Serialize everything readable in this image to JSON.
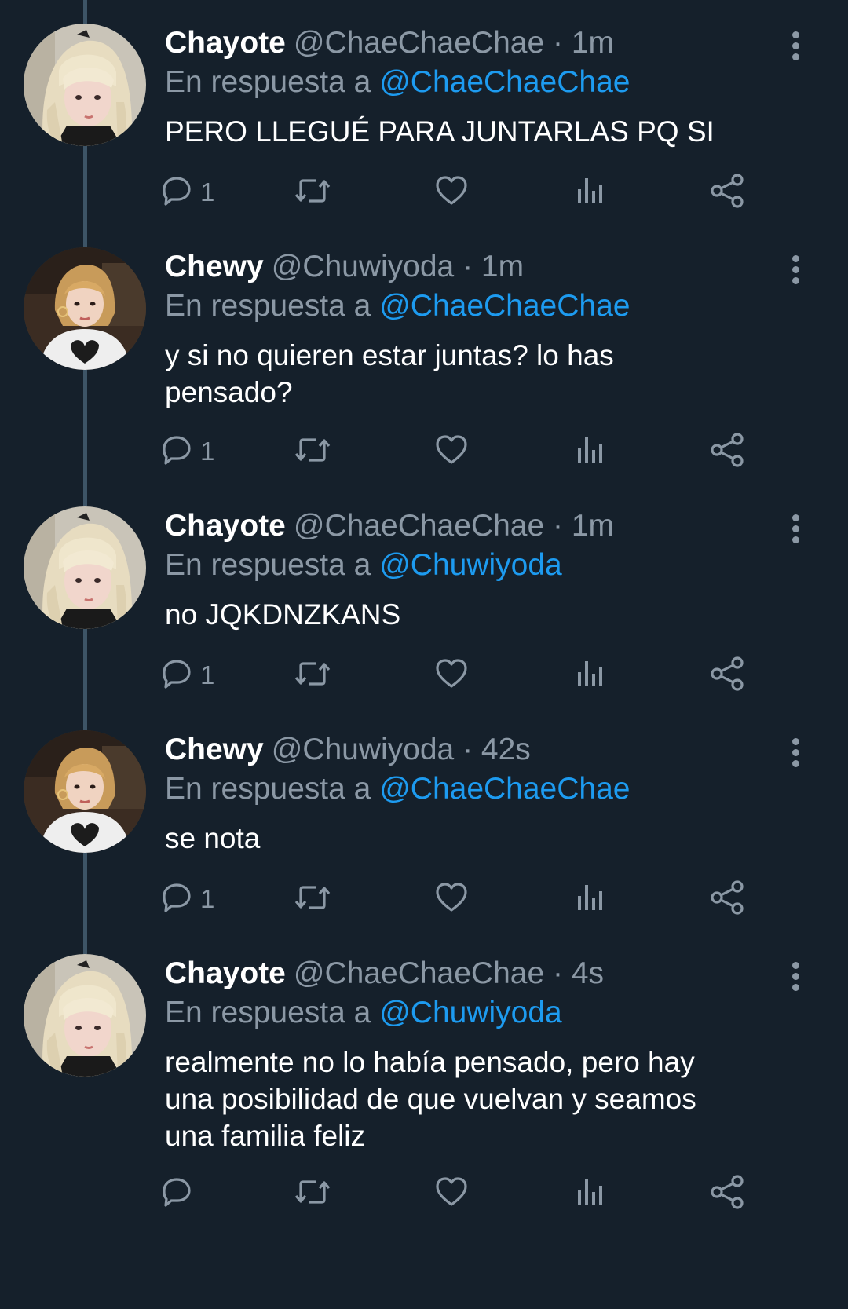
{
  "reply_prefix": "En respuesta a",
  "tweets": [
    {
      "name": "Chayote",
      "handle": "@ChaeChaeChae",
      "time": "1m",
      "reply_to": "@ChaeChaeChae",
      "text": "PERO LLEGUÉ PARA JUNTARLAS PQ SI",
      "replies": "1",
      "avatar": "blonde-avatar"
    },
    {
      "name": "Chewy",
      "handle": "@Chuwiyoda",
      "time": "1m",
      "reply_to": "@ChaeChaeChae",
      "text": "y si no quieren estar juntas? lo has\npensado?",
      "replies": "1",
      "avatar": "dark-hair-avatar"
    },
    {
      "name": "Chayote",
      "handle": "@ChaeChaeChae",
      "time": "1m",
      "reply_to": "@Chuwiyoda",
      "text": "no JQKDNZKANS",
      "replies": "1",
      "avatar": "blonde-avatar"
    },
    {
      "name": "Chewy",
      "handle": "@Chuwiyoda",
      "time": "42s",
      "reply_to": "@ChaeChaeChae",
      "text": "se nota",
      "replies": "1",
      "avatar": "dark-hair-avatar"
    },
    {
      "name": "Chayote",
      "handle": "@ChaeChaeChae",
      "time": "4s",
      "reply_to": "@Chuwiyoda",
      "text": "realmente no lo había pensado, pero hay\nuna posibilidad de que vuelvan y seamos\nuna familia feliz",
      "replies": "",
      "avatar": "blonde-avatar"
    }
  ],
  "colors": {
    "background": "#15202b",
    "text": "#ffffff",
    "muted": "#8b98a5",
    "accent": "#1d9bf0",
    "thread": "#3d5466"
  },
  "icons": [
    "reply-icon",
    "retweet-icon",
    "like-icon",
    "analytics-icon",
    "share-icon",
    "more-options-icon"
  ]
}
